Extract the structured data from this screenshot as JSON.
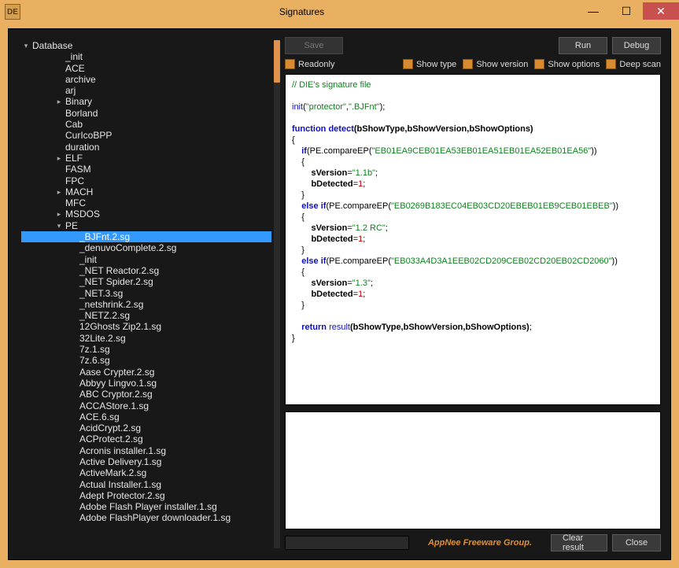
{
  "window": {
    "title": "Signatures",
    "app_icon_text": "DE"
  },
  "buttons": {
    "save": "Save",
    "run": "Run",
    "debug": "Debug",
    "clear_result": "Clear result",
    "close": "Close"
  },
  "options": {
    "readonly": "Readonly",
    "show_type": "Show type",
    "show_version": "Show version",
    "show_options": "Show options",
    "deep_scan": "Deep scan"
  },
  "credit": "AppNee Freeware Group.",
  "tree": {
    "root": "Database",
    "items": [
      {
        "label": "_init",
        "indent": 2,
        "caret": ""
      },
      {
        "label": "ACE",
        "indent": 2,
        "caret": ""
      },
      {
        "label": "archive",
        "indent": 2,
        "caret": ""
      },
      {
        "label": "arj",
        "indent": 2,
        "caret": ""
      },
      {
        "label": "Binary",
        "indent": 2,
        "caret": "▸"
      },
      {
        "label": "Borland",
        "indent": 2,
        "caret": ""
      },
      {
        "label": "Cab",
        "indent": 2,
        "caret": ""
      },
      {
        "label": "CurIcoBPP",
        "indent": 2,
        "caret": ""
      },
      {
        "label": "duration",
        "indent": 2,
        "caret": ""
      },
      {
        "label": "ELF",
        "indent": 2,
        "caret": "▸"
      },
      {
        "label": "FASM",
        "indent": 2,
        "caret": ""
      },
      {
        "label": "FPC",
        "indent": 2,
        "caret": ""
      },
      {
        "label": "MACH",
        "indent": 2,
        "caret": "▸"
      },
      {
        "label": "MFC",
        "indent": 2,
        "caret": ""
      },
      {
        "label": "MSDOS",
        "indent": 2,
        "caret": "▸"
      },
      {
        "label": "PE",
        "indent": 2,
        "caret": "▾"
      },
      {
        "label": "_BJFnt.2.sg",
        "indent": 3,
        "caret": "",
        "selected": true
      },
      {
        "label": "_denuvoComplete.2.sg",
        "indent": 3,
        "caret": ""
      },
      {
        "label": "_init",
        "indent": 3,
        "caret": ""
      },
      {
        "label": "_NET Reactor.2.sg",
        "indent": 3,
        "caret": ""
      },
      {
        "label": "_NET Spider.2.sg",
        "indent": 3,
        "caret": ""
      },
      {
        "label": "_NET.3.sg",
        "indent": 3,
        "caret": ""
      },
      {
        "label": "_netshrink.2.sg",
        "indent": 3,
        "caret": ""
      },
      {
        "label": "_NETZ.2.sg",
        "indent": 3,
        "caret": ""
      },
      {
        "label": "12Ghosts Zip2.1.sg",
        "indent": 3,
        "caret": ""
      },
      {
        "label": "32Lite.2.sg",
        "indent": 3,
        "caret": ""
      },
      {
        "label": "7z.1.sg",
        "indent": 3,
        "caret": ""
      },
      {
        "label": "7z.6.sg",
        "indent": 3,
        "caret": ""
      },
      {
        "label": "Aase Crypter.2.sg",
        "indent": 3,
        "caret": ""
      },
      {
        "label": "Abbyy Lingvo.1.sg",
        "indent": 3,
        "caret": ""
      },
      {
        "label": "ABC Cryptor.2.sg",
        "indent": 3,
        "caret": ""
      },
      {
        "label": "ACCAStore.1.sg",
        "indent": 3,
        "caret": ""
      },
      {
        "label": "ACE.6.sg",
        "indent": 3,
        "caret": ""
      },
      {
        "label": "AcidCrypt.2.sg",
        "indent": 3,
        "caret": ""
      },
      {
        "label": "ACProtect.2.sg",
        "indent": 3,
        "caret": ""
      },
      {
        "label": "Acronis installer.1.sg",
        "indent": 3,
        "caret": ""
      },
      {
        "label": "Active Delivery.1.sg",
        "indent": 3,
        "caret": ""
      },
      {
        "label": "ActiveMark.2.sg",
        "indent": 3,
        "caret": ""
      },
      {
        "label": "Actual Installer.1.sg",
        "indent": 3,
        "caret": ""
      },
      {
        "label": "Adept Protector.2.sg",
        "indent": 3,
        "caret": ""
      },
      {
        "label": "Adobe Flash Player installer.1.sg",
        "indent": 3,
        "caret": ""
      },
      {
        "label": "Adobe FlashPlayer downloader.1.sg",
        "indent": 3,
        "caret": ""
      }
    ]
  },
  "code": {
    "comment": "// DIE's signature file",
    "init_prefix": "init(",
    "init_arg1": "\"protector\"",
    "init_arg2": "\".BJFnt\"",
    "fn_kw": "function",
    "fn_name": "detect",
    "fn_args": "(bShowType,bShowVersion,bShowOptions)",
    "if_kw": "if",
    "else_kw": "else",
    "pe_call": "(PE.compareEP(",
    "ep1": "\"EB01EA9CEB01EA53EB01EA51EB01EA52EB01EA56\"",
    "ep2": "\"EB0269B183EC04EB03CD20EBEB01EB9CEB01EBEB\"",
    "ep3": "\"EB033A4D3A1EEB02CD209CEB02CD20EB02CD2060\"",
    "sver": "sVersion",
    "v1": "\"1.1b\"",
    "v2": "\"1.2 RC\"",
    "v3": "\"1.3\"",
    "bdet": "bDetected",
    "one": "1",
    "return_kw": "return",
    "result_fn": "result",
    "result_args": "(bShowType,bShowVersion,bShowOptions)"
  }
}
